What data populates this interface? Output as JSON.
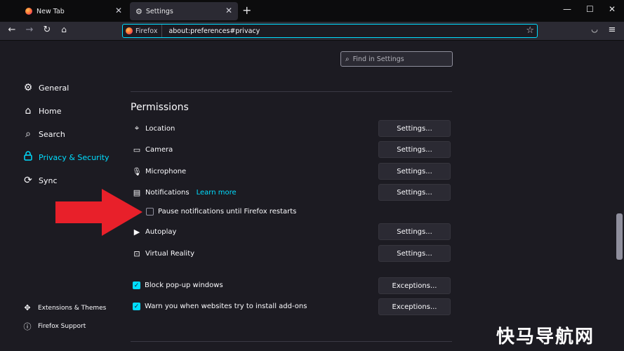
{
  "tabs": [
    {
      "label": "New Tab",
      "icon": "firefox-logo-icon"
    },
    {
      "label": "Settings",
      "icon": "gear-icon"
    }
  ],
  "window_controls": {
    "minimize": "—",
    "maximize": "☐",
    "close": "✕"
  },
  "urlbar": {
    "badge": "Firefox",
    "url": "about:preferences#privacy"
  },
  "search": {
    "placeholder": "Find in Settings"
  },
  "sidebar": {
    "items": [
      {
        "label": "General",
        "icon": "gear-icon"
      },
      {
        "label": "Home",
        "icon": "home-icon"
      },
      {
        "label": "Search",
        "icon": "search-icon"
      },
      {
        "label": "Privacy & Security",
        "icon": "lock-icon",
        "active": true
      },
      {
        "label": "Sync",
        "icon": "sync-icon"
      }
    ],
    "footer": [
      {
        "label": "Extensions & Themes",
        "icon": "puzzle-icon"
      },
      {
        "label": "Firefox Support",
        "icon": "help-icon"
      }
    ]
  },
  "permissions": {
    "title": "Permissions",
    "rows": [
      {
        "label": "Location",
        "icon": "location-icon",
        "button": "Settings..."
      },
      {
        "label": "Camera",
        "icon": "camera-icon",
        "button": "Settings..."
      },
      {
        "label": "Microphone",
        "icon": "microphone-icon",
        "button": "Settings..."
      },
      {
        "label": "Notifications",
        "icon": "notification-icon",
        "link": "Learn more",
        "button": "Settings..."
      },
      {
        "label": "Autoplay",
        "icon": "autoplay-icon",
        "button": "Settings..."
      },
      {
        "label": "Virtual Reality",
        "icon": "vr-icon",
        "button": "Settings..."
      }
    ],
    "pause_notifications": {
      "label": "Pause notifications until Firefox restarts",
      "checked": false
    },
    "block_popups": {
      "label": "Block pop-up windows",
      "checked": true,
      "button": "Exceptions..."
    },
    "warn_addons": {
      "label": "Warn you when websites try to install add-ons",
      "checked": true,
      "button": "Exceptions..."
    }
  },
  "watermark": "快马导航网",
  "colors": {
    "accent": "#00ddff",
    "arrow": "#e8202a",
    "background": "#1c1b22"
  }
}
